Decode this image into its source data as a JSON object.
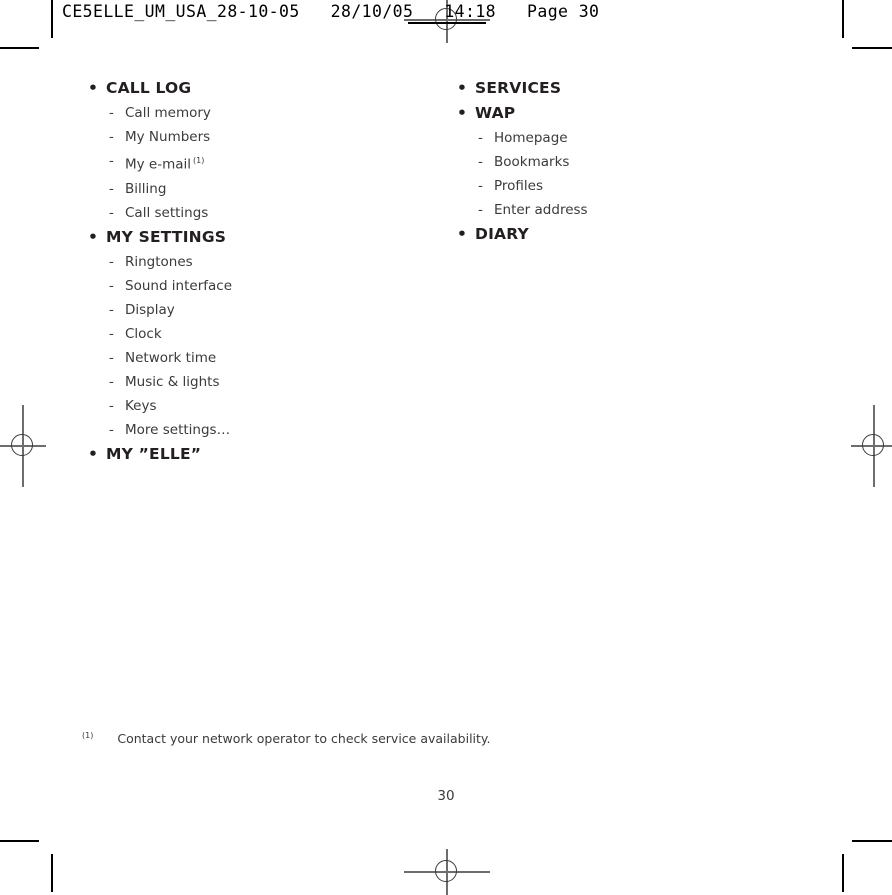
{
  "print_header": {
    "text": "CE5ELLE_UM_USA_28-10-05   28/10/05   14:18   Page 30",
    "filename": "CE5ELLE_UM_USA_28-10-05",
    "date": "28/10/05",
    "time": "14:18",
    "page_label": "Page 30"
  },
  "bullet_glyph": "•",
  "dash_glyph": "-",
  "columns": {
    "left": [
      {
        "heading": "CALL LOG",
        "sub_items": [
          {
            "label": "Call memory"
          },
          {
            "label": "My Numbers"
          },
          {
            "label": "My e-mail",
            "footnote": "(1)"
          },
          {
            "label": "Billing"
          },
          {
            "label": "Call settings"
          }
        ]
      },
      {
        "heading": "MY SETTINGS",
        "sub_items": [
          {
            "label": "Ringtones"
          },
          {
            "label": "Sound interface"
          },
          {
            "label": "Display"
          },
          {
            "label": "Clock"
          },
          {
            "label": "Network time"
          },
          {
            "label": "Music & lights"
          },
          {
            "label": "Keys"
          },
          {
            "label": "More settings…"
          }
        ]
      },
      {
        "heading": "MY ”ELLE”",
        "sub_items": []
      }
    ],
    "right": [
      {
        "heading": "SERVICES",
        "sub_items": []
      },
      {
        "heading": "WAP",
        "sub_items": [
          {
            "label": "Homepage"
          },
          {
            "label": "Bookmarks"
          },
          {
            "label": "Profiles"
          },
          {
            "label": "Enter address"
          }
        ]
      },
      {
        "heading": "DIARY",
        "sub_items": []
      }
    ]
  },
  "footnote": {
    "marker": "(1)",
    "text": "Contact your network operator to check service availability."
  },
  "page_number": "30",
  "colors": {
    "text": "#231f20",
    "body_text": "#3c3a3b",
    "crop_mark": "#000000",
    "registration_ring": "#3a3a3a",
    "registration_line": "#6d6d6d",
    "background": "#ffffff"
  }
}
